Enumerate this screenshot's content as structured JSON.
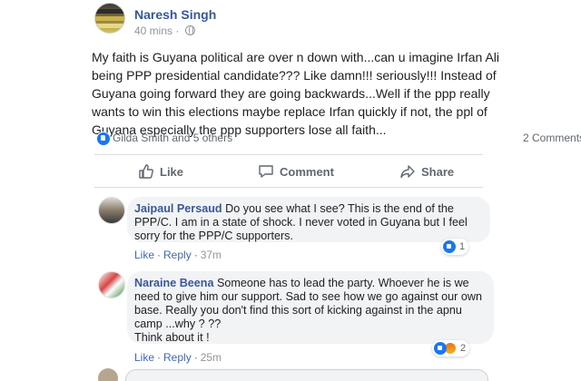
{
  "post": {
    "author": "Naresh Singh",
    "time": "40 mins",
    "text_lines": [
      "My faith is Guyana political are over n down with...can u imagine Irfan Ali",
      "being PPP presidential candidate??? Like damn!!! seriously!!! Instead of",
      "Guyana going forward they are going backwards...Well if the ppp really",
      "wants to win this elections maybe replace Irfan quickly if not, the ppl of",
      "Guyana especially the ppp supporters lose all faith..."
    ],
    "reactions_text": "Gilda Smith and 5 others",
    "comments_count": "2 Comments"
  },
  "actions": {
    "like": "Like",
    "comment": "Comment",
    "share": "Share"
  },
  "comments": [
    {
      "name": "Jaipaul Persaud",
      "lines": [
        "Do you see what I see? This is the end of the",
        "PPP/C. I am in a state of shock. I never voted in Guyana but I feel",
        "sorry for the PPP/C supporters."
      ],
      "like_label": "Like",
      "reply_label": "Reply",
      "time": "37m",
      "reaction_count": "1"
    },
    {
      "name": "Naraine Beena",
      "lines": [
        "Someone has to lead the party. Whoever he is we",
        "need to give him our support. Sad to see how we go against our own",
        "base. Really you don't find this sort of kicking against in the apnu",
        "camp ...why ? ??",
        "Think about it !"
      ],
      "like_label": "Like",
      "reply_label": "Reply",
      "time": "25m",
      "reaction_count": "2"
    }
  ],
  "icons": {
    "post_avatar": "avatar-image",
    "globe": "globe-icon",
    "like": "thumbs-up-icon",
    "comment": "speech-bubble-icon",
    "share": "share-arrow-icon"
  },
  "colors": {
    "link": "#365899",
    "like_blue": "#1877f2",
    "bubble_bg": "#f2f3f5",
    "meta_gray": "#90949c"
  }
}
